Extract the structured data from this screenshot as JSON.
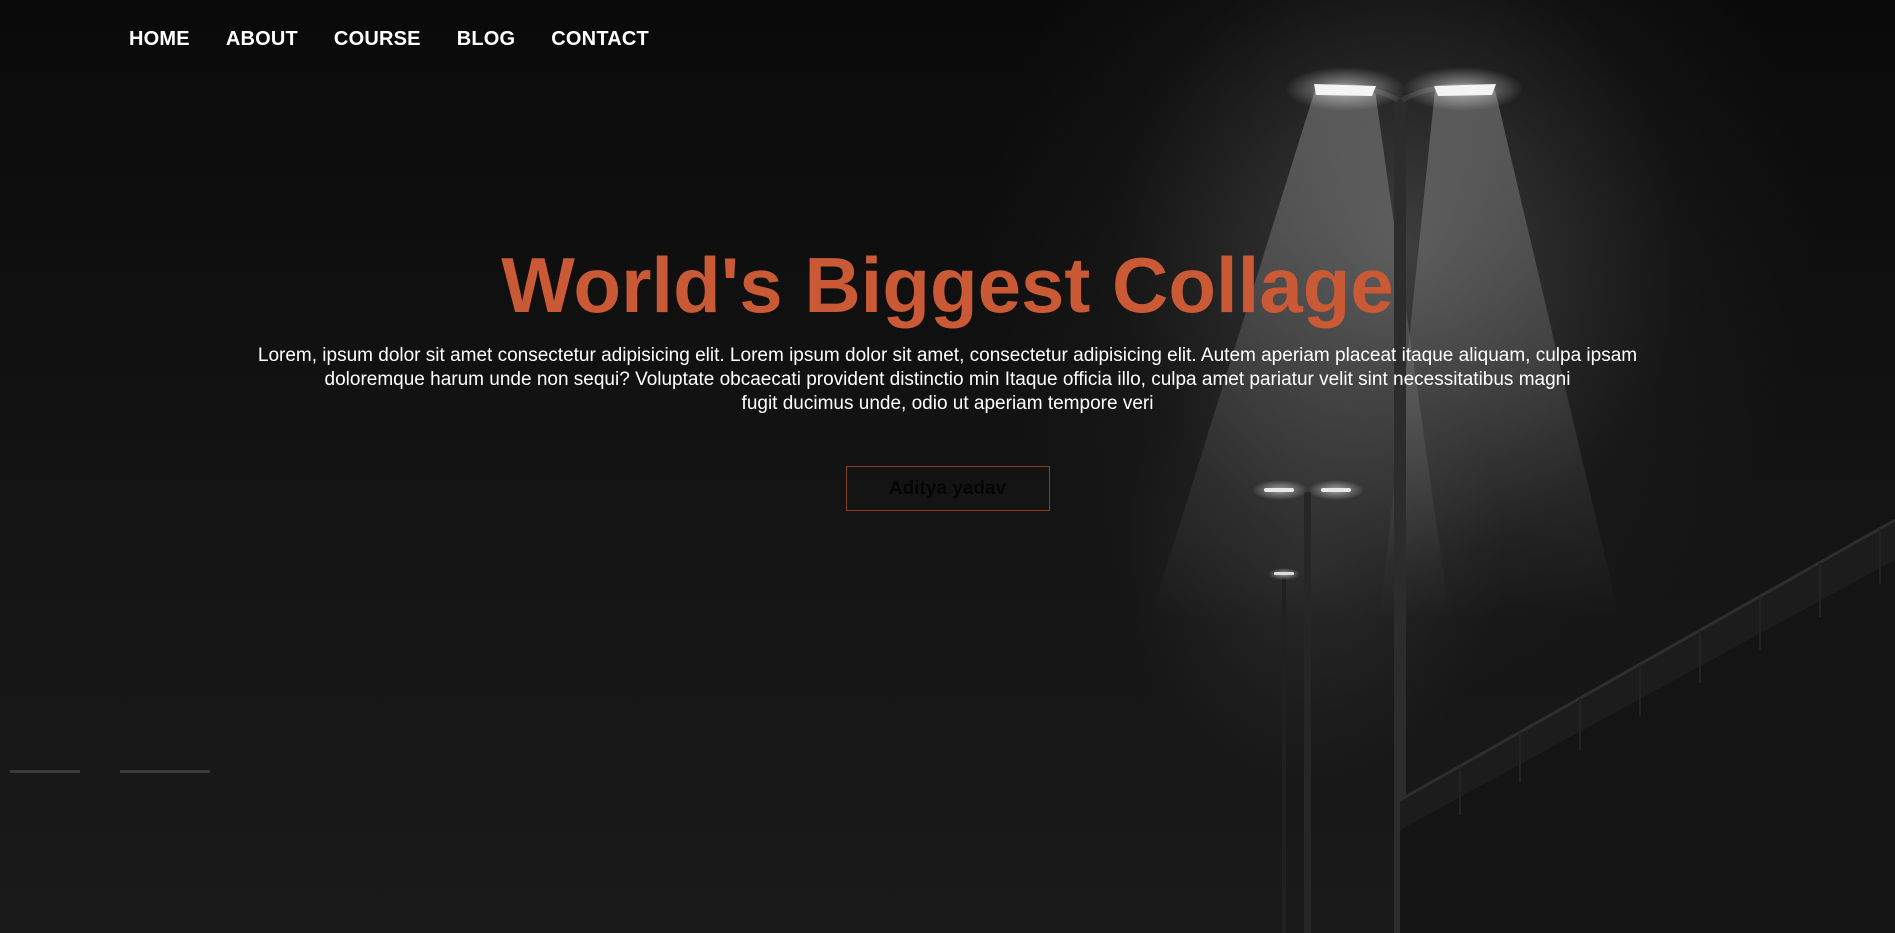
{
  "nav": {
    "items": [
      {
        "label": "HOME"
      },
      {
        "label": "ABOUT"
      },
      {
        "label": "COURSE"
      },
      {
        "label": "BLOG"
      },
      {
        "label": "CONTACT"
      }
    ]
  },
  "hero": {
    "title": "World's Biggest Collage",
    "description_lines": [
      "Lorem, ipsum dolor sit amet consectetur adipisicing elit. Lorem ipsum dolor sit amet, consectetur adipisicing elit. Autem aperiam placeat itaque aliquam, culpa ipsam",
      "doloremque harum unde non sequi? Voluptate obcaecati provident distinctio min Itaque officia illo, culpa amet pariatur velit sint necessitatibus magni",
      "fugit ducimus unde, odio ut aperiam tempore veri"
    ],
    "button_label": "Aditya yadav"
  },
  "colors": {
    "accent": "#c95a35",
    "button_border": "#8a3d22",
    "text": "#ffffff",
    "background": "#0b0b0b"
  }
}
